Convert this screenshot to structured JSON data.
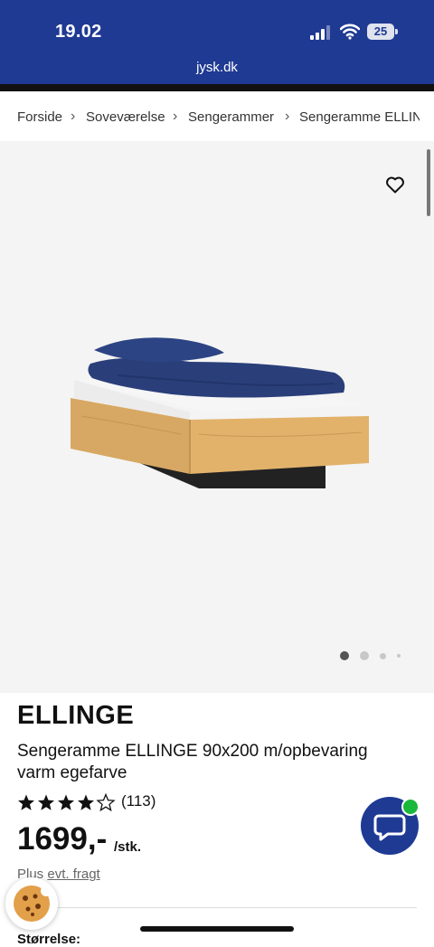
{
  "status_bar": {
    "time": "19.02",
    "url": "jysk.dk",
    "battery": "25"
  },
  "breadcrumb": [
    "Forside",
    "Soveværelse",
    "Sengerammer",
    "Sengeramme ELLINGE"
  ],
  "gallery": {
    "image_count": 4,
    "active_index": 0
  },
  "product": {
    "brand": "ELLINGE",
    "description": "Sengeramme ELLINGE 90x200 m/opbevaring varm egefarve",
    "rating": 4,
    "rating_max": 5,
    "rating_count": "(113)",
    "price": "1699,-",
    "unit": "/stk.",
    "shipping_prefix": "Plus",
    "shipping_link": "evt. fragt",
    "size_label": "Størrelse:"
  },
  "colors": {
    "brand_blue": "#1f3a93",
    "online_green": "#18b83a"
  },
  "icons": {
    "favorite": "heart-outline-icon",
    "chat": "chat-bubble-icon",
    "cookie": "cookie-icon"
  }
}
